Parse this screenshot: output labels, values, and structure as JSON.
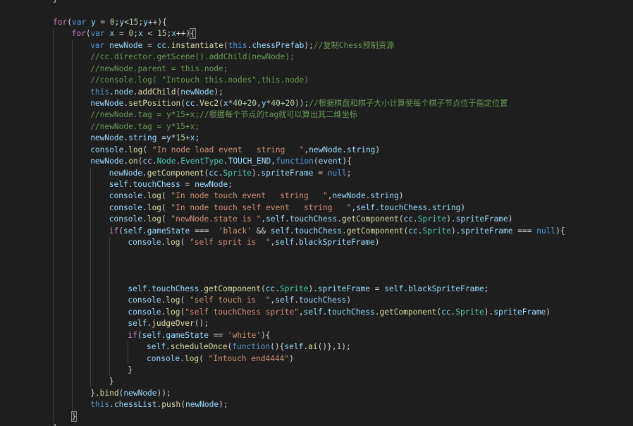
{
  "theme": {
    "background": "#1e1e1e",
    "keyword": "#569cd6",
    "control": "#c586c0",
    "function": "#dcdcaa",
    "string": "#ce9178",
    "number": "#b5cea8",
    "comment": "#6a9955",
    "property": "#9cdcfe",
    "type": "#4ec9b0",
    "text": "#d4d4d4"
  },
  "lines": [
    {
      "indent": 0,
      "tokens": [
        [
          "punc",
          "}"
        ]
      ]
    },
    {
      "indent": 0,
      "tokens": []
    },
    {
      "indent": 0,
      "tokens": [
        [
          "ctrl",
          "for"
        ],
        [
          "punc",
          "("
        ],
        [
          "kw",
          "var"
        ],
        [
          "punc",
          " "
        ],
        [
          "ident",
          "y"
        ],
        [
          "punc",
          " = "
        ],
        [
          "num",
          "0"
        ],
        [
          "punc",
          ";"
        ],
        [
          "ident",
          "y"
        ],
        [
          "punc",
          "<"
        ],
        [
          "num",
          "15"
        ],
        [
          "punc",
          ";"
        ],
        [
          "ident",
          "y"
        ],
        [
          "punc",
          "++){"
        ]
      ]
    },
    {
      "indent": 1,
      "tokens": [
        [
          "ctrl",
          "for"
        ],
        [
          "punc",
          "("
        ],
        [
          "kw",
          "var"
        ],
        [
          "punc",
          " "
        ],
        [
          "ident",
          "x"
        ],
        [
          "punc",
          " = "
        ],
        [
          "num",
          "0"
        ],
        [
          "punc",
          ";"
        ],
        [
          "ident",
          "x"
        ],
        [
          "punc",
          " < "
        ],
        [
          "num",
          "15"
        ],
        [
          "punc",
          ";"
        ],
        [
          "ident",
          "x"
        ],
        [
          "punc",
          "++)"
        ],
        [
          "brace",
          "{"
        ]
      ]
    },
    {
      "indent": 2,
      "tokens": [
        [
          "kw",
          "var"
        ],
        [
          "punc",
          " "
        ],
        [
          "ident",
          "newNode"
        ],
        [
          "punc",
          " = "
        ],
        [
          "ident",
          "cc"
        ],
        [
          "punc",
          "."
        ],
        [
          "fn",
          "instantiate"
        ],
        [
          "punc",
          "("
        ],
        [
          "kw",
          "this"
        ],
        [
          "punc",
          "."
        ],
        [
          "prop",
          "chessPrefab"
        ],
        [
          "punc",
          ");"
        ],
        [
          "cmt",
          "//复制Chess预制资源"
        ]
      ]
    },
    {
      "indent": 2,
      "tokens": [
        [
          "cmt",
          "//cc.director.getScene().addChild(newNode);"
        ]
      ]
    },
    {
      "indent": 2,
      "tokens": [
        [
          "cmt",
          "//newNode.parent = this.node;"
        ]
      ]
    },
    {
      "indent": 2,
      "tokens": [
        [
          "cmt",
          "//console.log( \"Intouch this.nodes\",this.node)"
        ]
      ]
    },
    {
      "indent": 2,
      "tokens": [
        [
          "kw",
          "this"
        ],
        [
          "punc",
          "."
        ],
        [
          "prop",
          "node"
        ],
        [
          "punc",
          "."
        ],
        [
          "fn",
          "addChild"
        ],
        [
          "punc",
          "("
        ],
        [
          "ident",
          "newNode"
        ],
        [
          "punc",
          ");"
        ]
      ]
    },
    {
      "indent": 2,
      "tokens": [
        [
          "ident",
          "newNode"
        ],
        [
          "punc",
          "."
        ],
        [
          "fn",
          "setPosition"
        ],
        [
          "punc",
          "("
        ],
        [
          "ident",
          "cc"
        ],
        [
          "punc",
          "."
        ],
        [
          "fn",
          "Vec2"
        ],
        [
          "punc",
          "("
        ],
        [
          "ident",
          "x"
        ],
        [
          "punc",
          "*"
        ],
        [
          "num",
          "40"
        ],
        [
          "punc",
          "+"
        ],
        [
          "num",
          "20"
        ],
        [
          "punc",
          ","
        ],
        [
          "ident",
          "y"
        ],
        [
          "punc",
          "*"
        ],
        [
          "num",
          "40"
        ],
        [
          "punc",
          "+"
        ],
        [
          "num",
          "20"
        ],
        [
          "punc",
          "));"
        ],
        [
          "cmt",
          "//根据棋盘和棋子大小计算使每个棋子节点位于指定位置"
        ]
      ]
    },
    {
      "indent": 2,
      "tokens": [
        [
          "cmt",
          "//newNode.tag = y*15+x;//根据每个节点的tag就可以算出其二维坐标"
        ]
      ]
    },
    {
      "indent": 2,
      "tokens": [
        [
          "cmt",
          "//newNode.tag = y*15+x;"
        ]
      ]
    },
    {
      "indent": 2,
      "tokens": [
        [
          "ident",
          "newNode"
        ],
        [
          "punc",
          "."
        ],
        [
          "prop",
          "string"
        ],
        [
          "punc",
          " ="
        ],
        [
          "ident",
          "y"
        ],
        [
          "punc",
          "*"
        ],
        [
          "num",
          "15"
        ],
        [
          "punc",
          "+"
        ],
        [
          "ident",
          "x"
        ],
        [
          "punc",
          ";"
        ]
      ]
    },
    {
      "indent": 2,
      "tokens": [
        [
          "ident",
          "console"
        ],
        [
          "punc",
          "."
        ],
        [
          "fn",
          "log"
        ],
        [
          "punc",
          "( "
        ],
        [
          "str",
          "\"In node load event   string   \""
        ],
        [
          "punc",
          ","
        ],
        [
          "ident",
          "newNode"
        ],
        [
          "punc",
          "."
        ],
        [
          "prop",
          "string"
        ],
        [
          "punc",
          ")"
        ]
      ]
    },
    {
      "indent": 2,
      "tokens": [
        [
          "ident",
          "newNode"
        ],
        [
          "punc",
          "."
        ],
        [
          "fn",
          "on"
        ],
        [
          "punc",
          "("
        ],
        [
          "ident",
          "cc"
        ],
        [
          "punc",
          "."
        ],
        [
          "type",
          "Node"
        ],
        [
          "punc",
          "."
        ],
        [
          "type",
          "EventType"
        ],
        [
          "punc",
          "."
        ],
        [
          "prop",
          "TOUCH_END"
        ],
        [
          "punc",
          ","
        ],
        [
          "kw",
          "function"
        ],
        [
          "punc",
          "("
        ],
        [
          "ident",
          "event"
        ],
        [
          "punc",
          "){"
        ]
      ]
    },
    {
      "indent": 3,
      "tokens": [
        [
          "ident",
          "newNode"
        ],
        [
          "punc",
          "."
        ],
        [
          "fn",
          "getComponent"
        ],
        [
          "punc",
          "("
        ],
        [
          "ident",
          "cc"
        ],
        [
          "punc",
          "."
        ],
        [
          "type",
          "Sprite"
        ],
        [
          "punc",
          ")."
        ],
        [
          "prop",
          "spriteFrame"
        ],
        [
          "punc",
          " = "
        ],
        [
          "kw",
          "null"
        ],
        [
          "punc",
          ";"
        ]
      ]
    },
    {
      "indent": 3,
      "tokens": [
        [
          "ident",
          "self"
        ],
        [
          "punc",
          "."
        ],
        [
          "prop",
          "touchChess"
        ],
        [
          "punc",
          " = "
        ],
        [
          "ident",
          "newNode"
        ],
        [
          "punc",
          ";"
        ]
      ]
    },
    {
      "indent": 3,
      "tokens": [
        [
          "ident",
          "console"
        ],
        [
          "punc",
          "."
        ],
        [
          "fn",
          "log"
        ],
        [
          "punc",
          "( "
        ],
        [
          "str",
          "\"In node touch event   string   \""
        ],
        [
          "punc",
          ","
        ],
        [
          "ident",
          "newNode"
        ],
        [
          "punc",
          "."
        ],
        [
          "prop",
          "string"
        ],
        [
          "punc",
          ")"
        ]
      ]
    },
    {
      "indent": 3,
      "tokens": [
        [
          "ident",
          "console"
        ],
        [
          "punc",
          "."
        ],
        [
          "fn",
          "log"
        ],
        [
          "punc",
          "( "
        ],
        [
          "str",
          "\"In node touch self event   string   \""
        ],
        [
          "punc",
          ","
        ],
        [
          "ident",
          "self"
        ],
        [
          "punc",
          "."
        ],
        [
          "prop",
          "touchChess"
        ],
        [
          "punc",
          "."
        ],
        [
          "prop",
          "string"
        ],
        [
          "punc",
          ")"
        ]
      ]
    },
    {
      "indent": 3,
      "tokens": [
        [
          "ident",
          "console"
        ],
        [
          "punc",
          "."
        ],
        [
          "fn",
          "log"
        ],
        [
          "punc",
          "( "
        ],
        [
          "str",
          "\"newNode.state is \""
        ],
        [
          "punc",
          ","
        ],
        [
          "ident",
          "self"
        ],
        [
          "punc",
          "."
        ],
        [
          "prop",
          "touchChess"
        ],
        [
          "punc",
          "."
        ],
        [
          "fn",
          "getComponent"
        ],
        [
          "punc",
          "("
        ],
        [
          "ident",
          "cc"
        ],
        [
          "punc",
          "."
        ],
        [
          "type",
          "Sprite"
        ],
        [
          "punc",
          ")."
        ],
        [
          "prop",
          "spriteFrame"
        ],
        [
          "punc",
          ")"
        ]
      ]
    },
    {
      "indent": 3,
      "tokens": [
        [
          "ctrl",
          "if"
        ],
        [
          "punc",
          "("
        ],
        [
          "ident",
          "self"
        ],
        [
          "punc",
          "."
        ],
        [
          "prop",
          "gameState"
        ],
        [
          "punc",
          " ===  "
        ],
        [
          "str",
          "'black'"
        ],
        [
          "punc",
          " && "
        ],
        [
          "ident",
          "self"
        ],
        [
          "punc",
          "."
        ],
        [
          "prop",
          "touchChess"
        ],
        [
          "punc",
          "."
        ],
        [
          "fn",
          "getComponent"
        ],
        [
          "punc",
          "("
        ],
        [
          "ident",
          "cc"
        ],
        [
          "punc",
          "."
        ],
        [
          "type",
          "Sprite"
        ],
        [
          "punc",
          ")."
        ],
        [
          "prop",
          "spriteFrame"
        ],
        [
          "punc",
          " === "
        ],
        [
          "kw",
          "null"
        ],
        [
          "punc",
          "){"
        ]
      ]
    },
    {
      "indent": 4,
      "tokens": [
        [
          "ident",
          "console"
        ],
        [
          "punc",
          "."
        ],
        [
          "fn",
          "log"
        ],
        [
          "punc",
          "( "
        ],
        [
          "str",
          "\"self sprit is  \""
        ],
        [
          "punc",
          ","
        ],
        [
          "ident",
          "self"
        ],
        [
          "punc",
          "."
        ],
        [
          "prop",
          "blackSpriteFrame"
        ],
        [
          "punc",
          ")"
        ]
      ]
    },
    {
      "indent": 4,
      "tokens": []
    },
    {
      "indent": 4,
      "tokens": []
    },
    {
      "indent": 4,
      "tokens": []
    },
    {
      "indent": 4,
      "tokens": [
        [
          "ident",
          "self"
        ],
        [
          "punc",
          "."
        ],
        [
          "prop",
          "touchChess"
        ],
        [
          "punc",
          "."
        ],
        [
          "fn",
          "getComponent"
        ],
        [
          "punc",
          "("
        ],
        [
          "ident",
          "cc"
        ],
        [
          "punc",
          "."
        ],
        [
          "type",
          "Sprite"
        ],
        [
          "punc",
          ")."
        ],
        [
          "prop",
          "spriteFrame"
        ],
        [
          "punc",
          " = "
        ],
        [
          "ident",
          "self"
        ],
        [
          "punc",
          "."
        ],
        [
          "prop",
          "blackSpriteFrame"
        ],
        [
          "punc",
          ";"
        ]
      ]
    },
    {
      "indent": 4,
      "tokens": [
        [
          "ident",
          "console"
        ],
        [
          "punc",
          "."
        ],
        [
          "fn",
          "log"
        ],
        [
          "punc",
          "( "
        ],
        [
          "str",
          "\"self touch is  \""
        ],
        [
          "punc",
          ","
        ],
        [
          "ident",
          "self"
        ],
        [
          "punc",
          "."
        ],
        [
          "prop",
          "touchChess"
        ],
        [
          "punc",
          ")"
        ]
      ]
    },
    {
      "indent": 4,
      "tokens": [
        [
          "ident",
          "console"
        ],
        [
          "punc",
          "."
        ],
        [
          "fn",
          "log"
        ],
        [
          "punc",
          "("
        ],
        [
          "str",
          "\"self touchChess sprite\""
        ],
        [
          "punc",
          ","
        ],
        [
          "ident",
          "self"
        ],
        [
          "punc",
          "."
        ],
        [
          "prop",
          "touchChess"
        ],
        [
          "punc",
          "."
        ],
        [
          "fn",
          "getComponent"
        ],
        [
          "punc",
          "("
        ],
        [
          "ident",
          "cc"
        ],
        [
          "punc",
          "."
        ],
        [
          "type",
          "Sprite"
        ],
        [
          "punc",
          ")."
        ],
        [
          "prop",
          "spriteFrame"
        ],
        [
          "punc",
          ")"
        ]
      ]
    },
    {
      "indent": 4,
      "tokens": [
        [
          "ident",
          "self"
        ],
        [
          "punc",
          "."
        ],
        [
          "fn",
          "judgeOver"
        ],
        [
          "punc",
          "();"
        ]
      ]
    },
    {
      "indent": 4,
      "tokens": [
        [
          "ctrl",
          "if"
        ],
        [
          "punc",
          "("
        ],
        [
          "ident",
          "self"
        ],
        [
          "punc",
          "."
        ],
        [
          "prop",
          "gameState"
        ],
        [
          "punc",
          " == "
        ],
        [
          "str",
          "'white'"
        ],
        [
          "punc",
          "){"
        ]
      ]
    },
    {
      "indent": 5,
      "tokens": [
        [
          "ident",
          "self"
        ],
        [
          "punc",
          "."
        ],
        [
          "fn",
          "scheduleOnce"
        ],
        [
          "punc",
          "("
        ],
        [
          "kw",
          "function"
        ],
        [
          "punc",
          "(){"
        ],
        [
          "ident",
          "self"
        ],
        [
          "punc",
          "."
        ],
        [
          "fn",
          "ai"
        ],
        [
          "punc",
          "()},"
        ],
        [
          "num",
          "1"
        ],
        [
          "punc",
          ");"
        ]
      ]
    },
    {
      "indent": 5,
      "tokens": [
        [
          "ident",
          "console"
        ],
        [
          "punc",
          "."
        ],
        [
          "fn",
          "log"
        ],
        [
          "punc",
          "( "
        ],
        [
          "str",
          "\"Intouch end4444\""
        ],
        [
          "punc",
          ")"
        ]
      ]
    },
    {
      "indent": 4,
      "tokens": [
        [
          "punc",
          "}"
        ]
      ]
    },
    {
      "indent": 3,
      "tokens": [
        [
          "punc",
          "}"
        ]
      ]
    },
    {
      "indent": 2,
      "tokens": [
        [
          "punc",
          "}."
        ],
        [
          "fn",
          "bind"
        ],
        [
          "punc",
          "("
        ],
        [
          "ident",
          "newNode"
        ],
        [
          "punc",
          "));"
        ]
      ]
    },
    {
      "indent": 2,
      "tokens": [
        [
          "kw",
          "this"
        ],
        [
          "punc",
          "."
        ],
        [
          "prop",
          "chessList"
        ],
        [
          "punc",
          "."
        ],
        [
          "fn",
          "push"
        ],
        [
          "punc",
          "("
        ],
        [
          "ident",
          "newNode"
        ],
        [
          "punc",
          ");"
        ]
      ]
    },
    {
      "indent": 1,
      "tokens": [
        [
          "brace",
          "}"
        ]
      ]
    },
    {
      "indent": 0,
      "tokens": [
        [
          "punc",
          "}"
        ]
      ]
    }
  ]
}
